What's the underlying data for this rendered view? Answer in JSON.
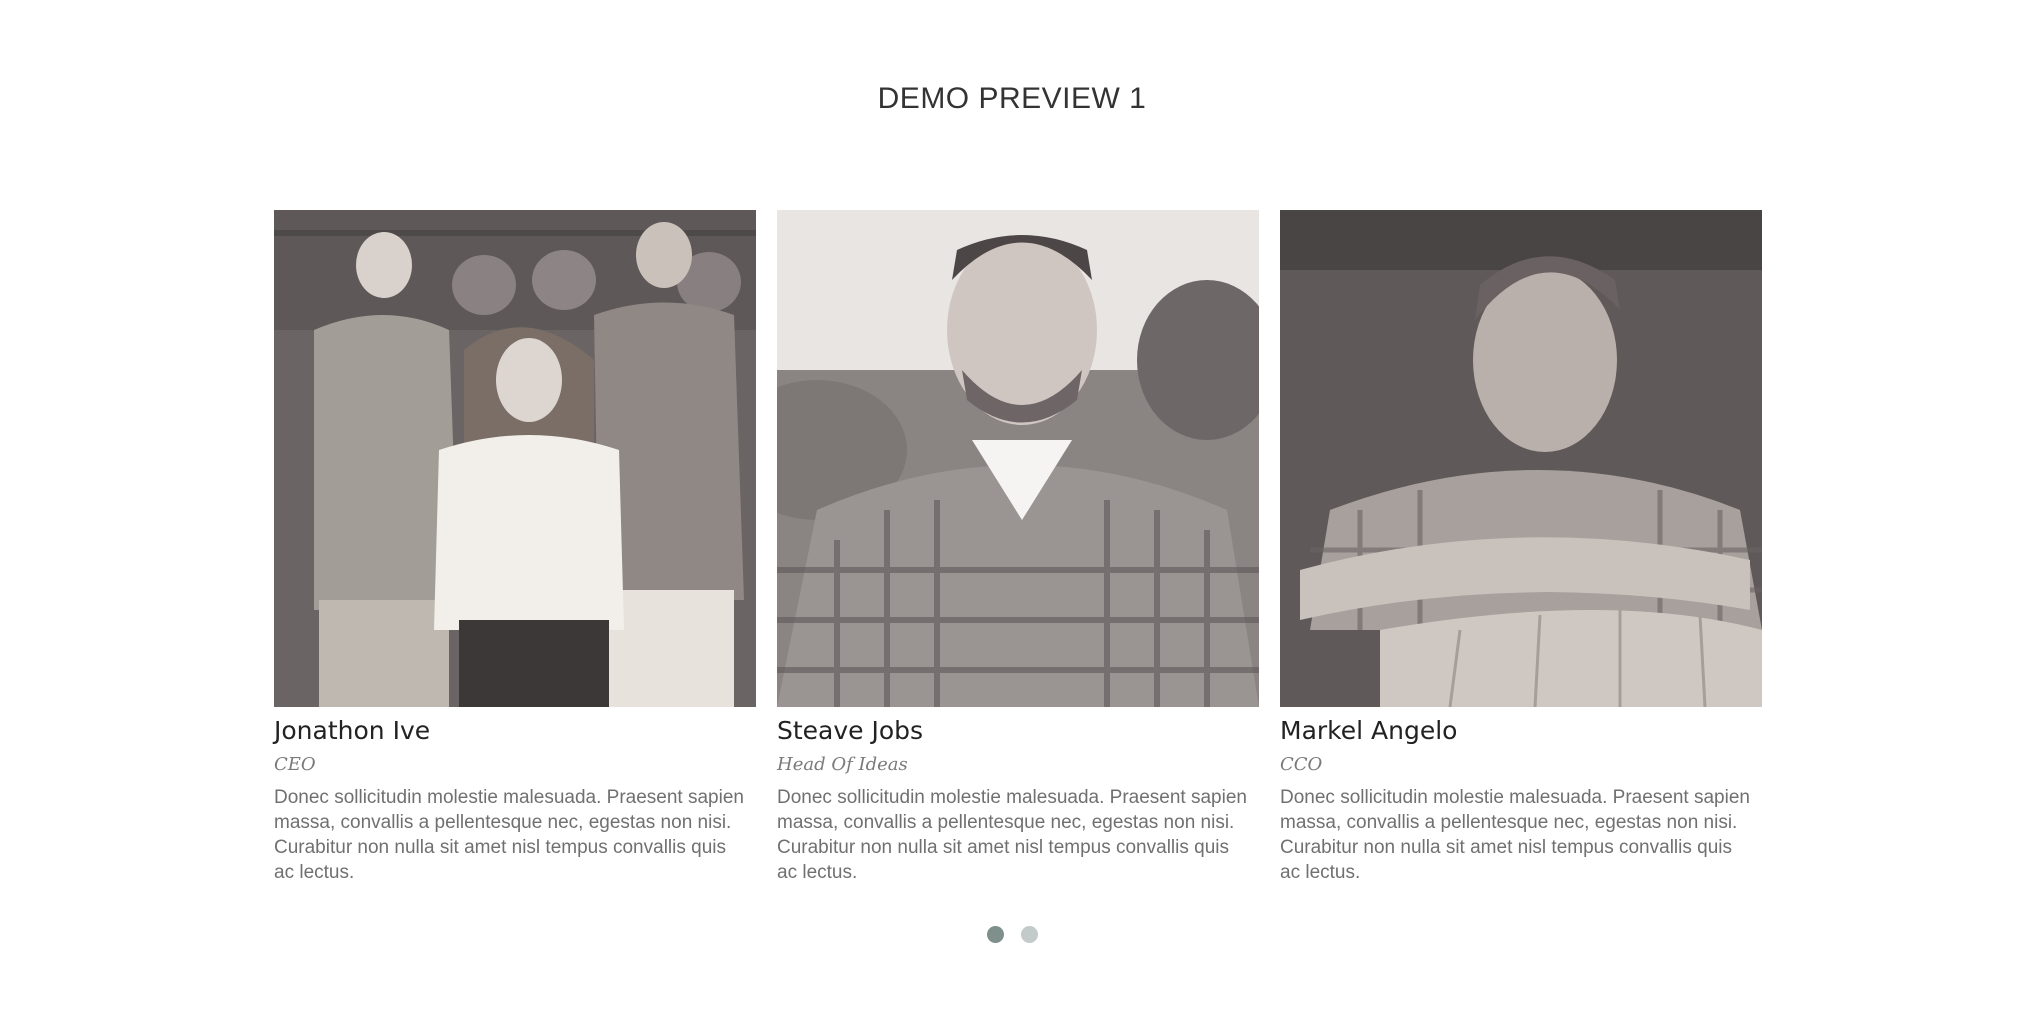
{
  "section": {
    "title": "DEMO PREVIEW 1"
  },
  "team": [
    {
      "name": "Jonathon Ive",
      "role": "CEO",
      "bio": "Donec sollicitudin molestie malesuada. Praesent sapien massa, convallis a pellentesque nec, egestas non nisi. Curabitur non nulla sit amet nisl tempus convallis quis ac lectus.",
      "photo_icon": "group-portrait-photo"
    },
    {
      "name": "Steave Jobs",
      "role": "Head Of Ideas",
      "bio": "Donec sollicitudin molestie malesuada. Praesent sapien massa, convallis a pellentesque nec, egestas non nisi. Curabitur non nulla sit amet nisl tempus convallis quis ac lectus.",
      "photo_icon": "portrait-photo"
    },
    {
      "name": "Markel Angelo",
      "role": "CCO",
      "bio": "Donec sollicitudin molestie malesuada. Praesent sapien massa, convallis a pellentesque nec, egestas non nisi. Curabitur non nulla sit amet nisl tempus convallis quis ac lectus.",
      "photo_icon": "portrait-photo"
    }
  ],
  "pagination": {
    "total": 2,
    "active": 1
  },
  "colors": {
    "dot_active": "#7f8f8c",
    "dot_inactive": "#c2cbc9",
    "photo_tone": "#6e6868"
  }
}
